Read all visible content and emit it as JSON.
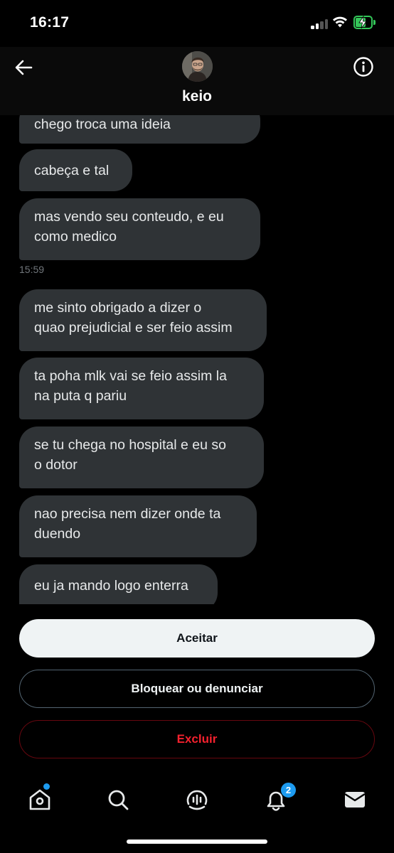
{
  "status_bar": {
    "time": "16:17"
  },
  "header": {
    "username": "keio"
  },
  "messages": [
    {
      "text": "chego troca uma ideia"
    },
    {
      "text": "cabeça e tal"
    },
    {
      "text": "mas vendo seu conteudo, e eu\ncomo medico"
    },
    {
      "text": "me sinto obrigado a dizer o\nquao prejudicial e ser feio assim"
    },
    {
      "text": "ta poha mlk vai se feio assim la\nna puta q pariu"
    },
    {
      "text": "se tu chega no hospital e eu so\no dotor"
    },
    {
      "text": "nao precisa nem dizer onde ta\nduendo"
    },
    {
      "text": "eu ja mando logo enterra"
    }
  ],
  "timestamp": "15:59",
  "actions": {
    "accept": "Aceitar",
    "block": "Bloquear ou denunciar",
    "delete": "Excluir"
  },
  "tabbar": {
    "icons": [
      "home-icon",
      "search-icon",
      "spaces-icon",
      "notifications-icon",
      "messages-icon"
    ],
    "notifications_badge": "2"
  },
  "colors": {
    "bubble": "#2f3336",
    "accent": "#1d9bf0",
    "danger": "#f4212e"
  }
}
